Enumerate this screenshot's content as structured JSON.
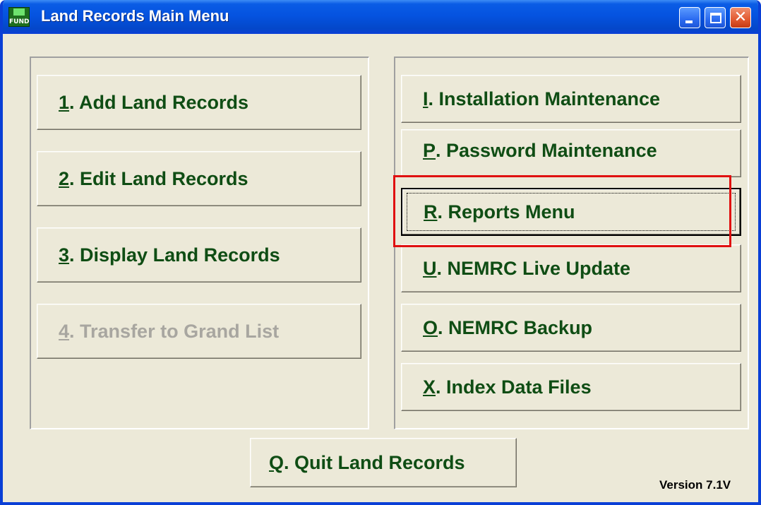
{
  "window": {
    "title": "Land Records Main Menu",
    "icon": "nemrc-fund-icon",
    "icon_text": "FUND",
    "controls": {
      "minimize": "minimize-icon",
      "maximize": "maximize-icon",
      "close": "close-icon",
      "close_glyph": "✕"
    }
  },
  "left_menu": [
    {
      "key": "1",
      "label": ".  Add Land Records",
      "enabled": true
    },
    {
      "key": "2",
      "label": ". Edit Land Records",
      "enabled": true
    },
    {
      "key": "3",
      "label": ". Display Land Records",
      "enabled": true
    },
    {
      "key": "4",
      "label": ". Transfer to Grand List",
      "enabled": false
    }
  ],
  "right_menu": [
    {
      "key": "I",
      "label": ".  Installation Maintenance"
    },
    {
      "key": "P",
      "label": ". Password Maintenance"
    },
    {
      "key": "R",
      "label": ". Reports Menu",
      "focused": true,
      "highlighted": true
    },
    {
      "key": "U",
      "label": ". NEMRC Live Update"
    },
    {
      "key": "O",
      "label": ". NEMRC Backup"
    },
    {
      "key": "X",
      "label": ".  Index Data Files"
    }
  ],
  "quit": {
    "key": "Q",
    "label": ". Quit Land Records"
  },
  "version": "Version 7.1V",
  "colors": {
    "label_green": "#0f4d14",
    "disabled_gray": "#a8a6a0",
    "highlight_red": "#e01010",
    "titlebar_blue": "#0553e0"
  }
}
